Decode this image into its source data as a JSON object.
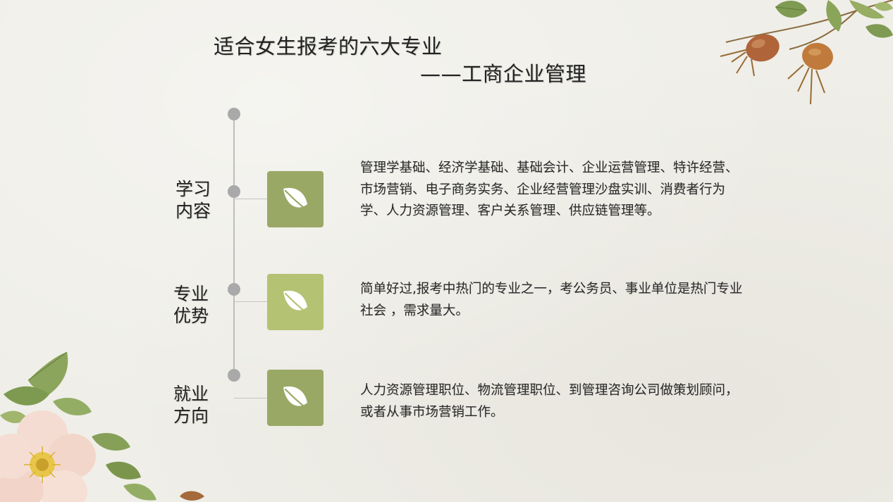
{
  "title": {
    "main": "适合女生报考的六大专业",
    "sub": "——工商企业管理"
  },
  "sections": [
    {
      "label_line1": "学习",
      "label_line2": "内容",
      "icon": "leaf-icon",
      "icon_color": "#9aa865",
      "text": "管理学基础、经济学基础、基础会计、企业运营管理、特许经营、市场营销、电子商务实务、企业经营管理沙盘实训、消费者行为学、人力资源管理、客户关系管理、供应链管理等。"
    },
    {
      "label_line1": "专业",
      "label_line2": "优势",
      "icon": "leaf-icon",
      "icon_color": "#b4c273",
      "text": "简单好过,报考中热门的专业之一，考公务员、事业单位是热门专业社会 ，需求量大。"
    },
    {
      "label_line1": "就业",
      "label_line2": "方向",
      "icon": "leaf-icon",
      "icon_color": "#9aa865",
      "text": "人力资源管理职位、物流管理职位、到管理咨询公司做策划顾问，或者从事市场营销工作。"
    }
  ],
  "decorations": {
    "top_right": "rosehip-branch",
    "bottom_left": "wild-rose-flower"
  }
}
